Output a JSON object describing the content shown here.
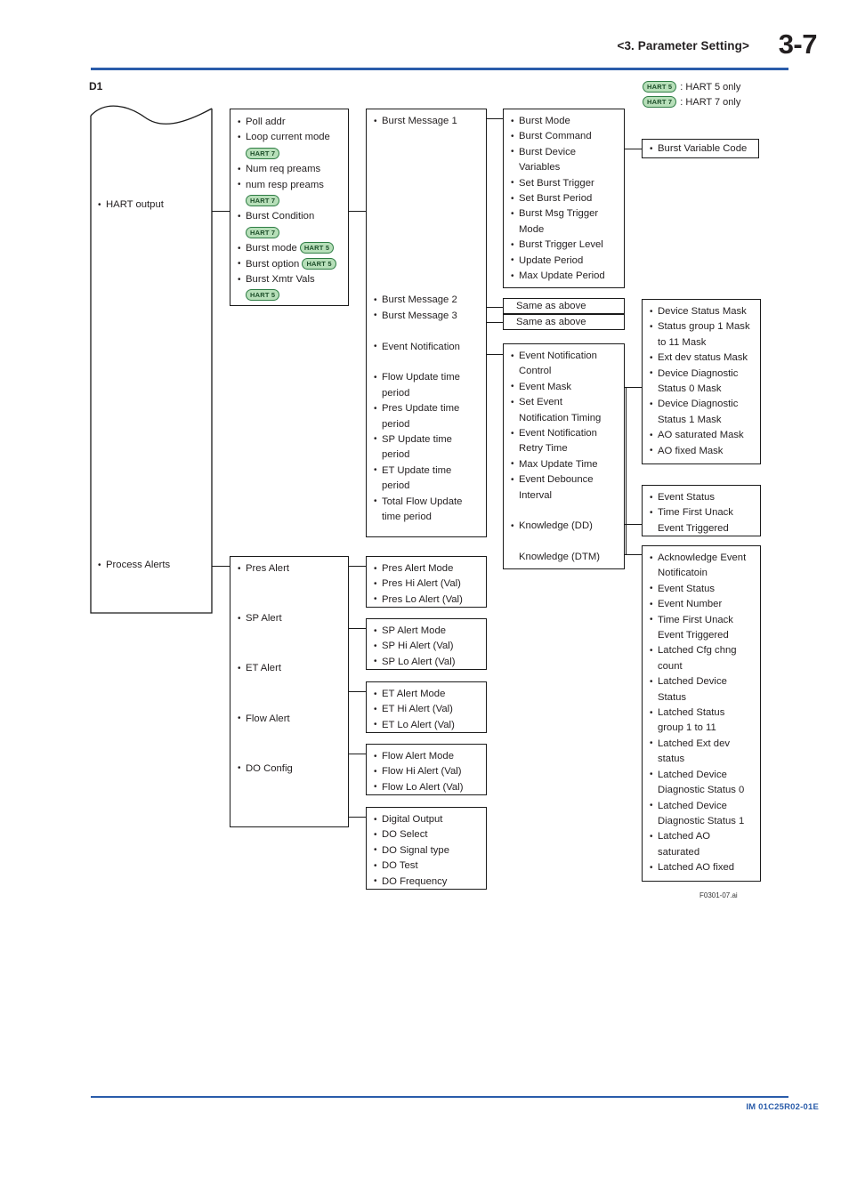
{
  "header": {
    "chapter_title": "<3.  Parameter Setting>",
    "page_number": "3-7",
    "figure_label": "D1"
  },
  "footer": {
    "doc_id": "IM 01C25R02-01E",
    "figure_caption": "F0301-07.ai"
  },
  "legend": [
    {
      "badge": "HART 5",
      "text": ": HART 5 only"
    },
    {
      "badge": "HART 7",
      "text": ": HART 7 only"
    }
  ],
  "roots": {
    "hart_output": "HART output",
    "process_alerts": "Process Alerts"
  },
  "boxes": {
    "hart_params": {
      "name": "hart-parameters-box",
      "items": [
        {
          "text": "Poll addr"
        },
        {
          "text": "Loop current mode",
          "badge_below": "HART 7"
        },
        {
          "text": "Num req preams"
        },
        {
          "text": "num resp preams",
          "badge_below": "HART 7"
        },
        {
          "text": "Burst Condition",
          "badge_below": "HART 7"
        },
        {
          "text": "Burst mode",
          "badge_inline": "HART 5"
        },
        {
          "text": "Burst option",
          "badge_inline": "HART 5"
        },
        {
          "text": "Burst Xmtr Vals",
          "badge_below": "HART 5"
        }
      ]
    },
    "burst_messages": {
      "name": "burst-messages-box",
      "items": [
        "Burst Message 1",
        "",
        "",
        "",
        "",
        "",
        "",
        "",
        "",
        "",
        "",
        "",
        "Burst Message 2",
        "Burst Message 3",
        "",
        "Event Notification",
        "",
        "Flow Update time",
        "period",
        "Pres Update time",
        "period",
        "SP Update time",
        "period",
        "ET Update time",
        "period",
        "Total Flow Update",
        "time period"
      ]
    },
    "burst_message_1_detail": {
      "name": "burst-message-1-detail-box",
      "items": [
        "Burst Mode",
        "Burst Command",
        "Burst Device",
        "Variables",
        "Set Burst Trigger",
        "Set Burst Period",
        "Burst Msg Trigger",
        "Mode",
        "Burst Trigger Level",
        "Update Period",
        "Max Update Period"
      ]
    },
    "same_as_above_1": {
      "name": "same-as-above-box-1",
      "text": "Same as above"
    },
    "same_as_above_2": {
      "name": "same-as-above-box-2",
      "text": "Same as above"
    },
    "event_notification_detail": {
      "name": "event-notification-detail-box",
      "items": [
        "Event Notification",
        "Control",
        "Event Mask",
        "Set Event",
        "Notification Timing",
        "Event Notification",
        "Retry Time",
        "Max Update Time",
        "Event Debounce",
        "Interval",
        "",
        "Knowledge (DD)",
        "",
        "Knowledge (DTM)"
      ]
    },
    "burst_variable_code": {
      "name": "burst-variable-code-box",
      "items": [
        "Burst Variable Code"
      ]
    },
    "device_status_mask": {
      "name": "device-status-mask-box",
      "items": [
        "Device Status Mask",
        "Status group 1 Mask",
        "to 11 Mask",
        "Ext dev status Mask",
        "Device Diagnostic",
        "Status 0 Mask",
        "Device Diagnostic",
        "Status 1 Mask",
        "AO saturated Mask",
        "AO fixed Mask"
      ]
    },
    "event_status": {
      "name": "event-status-box",
      "items": [
        "Event Status",
        "Time First Unack",
        "Event Triggered"
      ]
    },
    "acknowledge_event": {
      "name": "acknowledge-event-box",
      "items": [
        "Acknowledge Event",
        "Notificatoin",
        "Event Status",
        "Event Number",
        "Time First Unack",
        "Event Triggered",
        "Latched Cfg chng",
        "count",
        "Latched Device",
        "Status",
        "Latched Status",
        "group 1 to 11",
        "Latched Ext dev",
        "status",
        "Latched Device",
        "Diagnostic Status 0",
        "Latched Device",
        "Diagnostic Status 1",
        "Latched AO",
        "saturated",
        "Latched AO fixed"
      ]
    },
    "alerts_parents": {
      "name": "alerts-parents-box",
      "items": [
        "Pres Alert",
        "SP Alert",
        "ET Alert",
        "Flow Alert",
        "DO Config"
      ]
    },
    "pres_alert": {
      "name": "pres-alert-detail-box",
      "items": [
        "Pres Alert Mode",
        "Pres Hi Alert (Val)",
        "Pres Lo Alert (Val)"
      ]
    },
    "sp_alert": {
      "name": "sp-alert-detail-box",
      "items": [
        "SP Alert Mode",
        "SP Hi Alert (Val)",
        "SP Lo Alert (Val)"
      ]
    },
    "et_alert": {
      "name": "et-alert-detail-box",
      "items": [
        "ET Alert Mode",
        "ET Hi Alert (Val)",
        "ET Lo Alert (Val)"
      ]
    },
    "flow_alert": {
      "name": "flow-alert-detail-box",
      "items": [
        "Flow Alert Mode",
        "Flow Hi Alert (Val)",
        "Flow Lo Alert (Val)"
      ]
    },
    "do_config": {
      "name": "do-config-detail-box",
      "items": [
        "Digital Output",
        "DO Select",
        "DO Signal type",
        "DO Test",
        "DO Frequency"
      ]
    }
  },
  "colors": {
    "rule": "#2a5caa",
    "badge_fill": "#b7dfb9",
    "badge_border": "#2e7d44",
    "box_border": "#1a1a1a"
  }
}
